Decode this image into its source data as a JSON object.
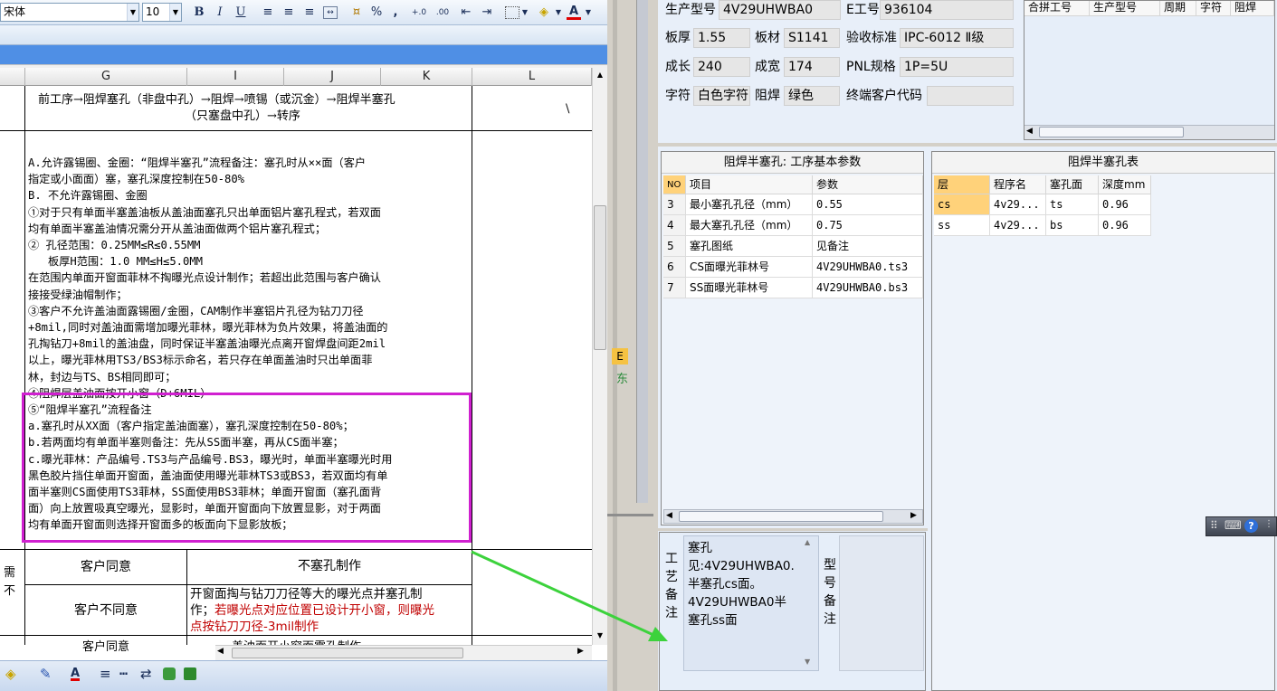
{
  "excel": {
    "font_name": "宋体",
    "font_size": "10",
    "toolbar": {
      "bold": "B",
      "italic": "I",
      "underline": "U",
      "percent": "%",
      "comma": ","
    },
    "columns": [
      "G",
      "I",
      "J",
      "K",
      "L"
    ],
    "row1": {
      "process_line1": "前工序→阻焊塞孔（非盘中孔）→阻焊→喷锡（或沉金）→阻焊半塞孔",
      "process_line2": "（只塞盘中孔）→转序",
      "l_value": "\\"
    },
    "notes": [
      "A.允许露锡圈、金圈：“阻焊半塞孔”流程备注：塞孔时从××面（客户",
      "指定或小面面）塞，塞孔深度控制在50-80%",
      "B. 不允许露锡圈、金圈",
      "①对于只有单面半塞盖油板从盖油面塞孔只出单面铝片塞孔程式，若双面",
      "均有单面半塞盖油情况需分开从盖油面做两个铝片塞孔程式；",
      "② 孔径范围：0.25MM≤R≤0.55MM",
      "   板厚H范围：1.0 MM≤H≤5.0MM",
      "在范围内单面开窗面菲林不掏曝光点设计制作；若超出此范围与客户确认",
      "接接受绿油帽制作；",
      "③客户不允许盖油面露锡圈/金圈，CAM制作半塞铝片孔径为钻刀刀径",
      "+8mil,同时对盖油面需增加曝光菲林，曝光菲林为负片效果，将盖油面的",
      "孔掏钻刀+8mil的盖油盘，同时保证半塞盖油曝光点离开窗焊盘间距2mil",
      "以上，曝光菲林用TS3/BS3标示命名，若只存在单面盖油时只出单面菲",
      "林，封边与TS、BS相同即可；",
      "④阻焊层盖油面按开小窗（D+6MIL）",
      "⑤“阻焊半塞孔”流程备注",
      "a.塞孔时从XX面（客户指定盖油面塞），塞孔深度控制在50-80%；",
      "b.若两面均有单面半塞则备注：先从SS面半塞，再从CS面半塞；",
      "c.曝光菲林：产品编号.TS3与产品编号.BS3，曝光时，单面半塞曝光时用",
      "黑色胶片挡住单面开窗面，盖油面使用曝光菲林TS3或BS3，若双面均有单",
      "面半塞则CS面使用TS3菲林，SS面使用BS3菲林；单面开窗面（塞孔面背",
      "面）向上放置吸真空曝光，显影时，单面开窗面向下放置显影，对于两面",
      "均有单面开窗面则选择开窗面多的板面向下显影放板；"
    ],
    "left_cut1": "需",
    "left_cut2": "不",
    "customer_agree": "客户同意",
    "no_plug": "不塞孔制作",
    "customer_disagree": "客户不同意",
    "disagree_text1": "开窗面掏与钻刀刀径等大的曝光点并塞孔制",
    "disagree_text2a": "作；",
    "disagree_text2b": "若曝光点对应位置已设计开小窗，则曝光",
    "disagree_text3": "点按钻刀刀径-3mil制作",
    "next_row_partial1": "客户同意",
    "next_row_partial2": "盖油面开小窗面露孔制作"
  },
  "gap": {
    "frag1": "E",
    "frag2": "东"
  },
  "erp": {
    "fields": {
      "model_label": "生产型号",
      "model_value": "4V29UHWBA0",
      "eno_label": "E工号",
      "eno_value": "936104",
      "thick_label": "板厚",
      "thick_value": "1.55",
      "material_label": "板材",
      "material_value": "S1141",
      "std_label": "验收标准",
      "std_value": "IPC-6012 Ⅱ级",
      "len_label": "成长",
      "len_value": "240",
      "wid_label": "成宽",
      "wid_value": "174",
      "pnl_label": "PNL规格",
      "pnl_value": "1P=5U",
      "char_label": "字符",
      "char_value": "白色字符",
      "mask_label": "阻焊",
      "mask_value": "绿色",
      "cust_label": "终端客户代码",
      "cust_value": ""
    },
    "combine_table": {
      "headers": [
        "合拼工号",
        "生产型号",
        "周期",
        "字符",
        "阻焊"
      ]
    },
    "params_panel": {
      "title": "阻焊半塞孔: 工序基本参数",
      "headers": [
        "NO",
        "项目",
        "参数"
      ],
      "rows": [
        {
          "no": "3",
          "item": "最小塞孔孔径（mm）",
          "value": "0.55"
        },
        {
          "no": "4",
          "item": "最大塞孔孔径（mm）",
          "value": "0.75"
        },
        {
          "no": "5",
          "item": "塞孔图纸",
          "value": "见备注"
        },
        {
          "no": "6",
          "item": "CS面曝光菲林号",
          "value": "4V29UHWBA0.ts3"
        },
        {
          "no": "7",
          "item": "SS面曝光菲林号",
          "value": "4V29UHWBA0.bs3"
        }
      ]
    },
    "plug_table": {
      "title": "阻焊半塞孔表",
      "headers": [
        "层",
        "程序名",
        "塞孔面",
        "深度mm"
      ],
      "rows": [
        {
          "layer": "cs",
          "prog": "4v29...",
          "face": "ts",
          "depth": "0.96"
        },
        {
          "layer": "ss",
          "prog": "4v29...",
          "face": "bs",
          "depth": "0.96"
        }
      ]
    },
    "remarks": {
      "process_label": [
        "工",
        "艺",
        "备",
        "注"
      ],
      "process_text": [
        "塞孔",
        "见:4V29UHWBA0.",
        "半塞孔cs面。",
        "4V29UHWBA0半",
        "塞孔ss面"
      ],
      "model_label": [
        "型",
        "号",
        "备",
        "注"
      ]
    }
  },
  "colors": {
    "highlight_box": "#d020d0",
    "arrow": "#3cd23c",
    "red_text": "#c00000",
    "selected_row": "#ffd27a"
  }
}
